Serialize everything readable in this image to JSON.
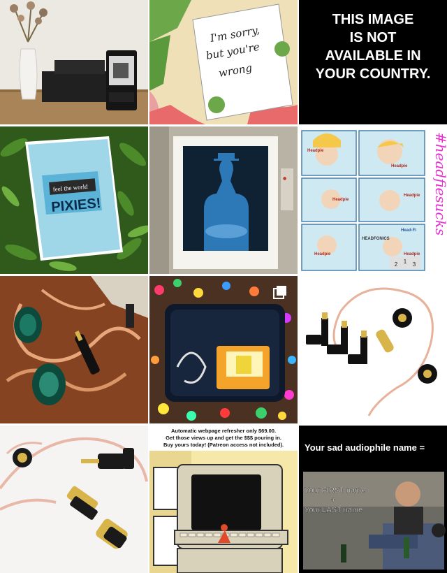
{
  "grid": {
    "posts": [
      {
        "id": "post-1",
        "desc": "headphone amplifier photo"
      },
      {
        "id": "post-2",
        "note_text": [
          "I'm sorry,",
          "but you're",
          "wrong"
        ]
      },
      {
        "id": "post-3",
        "lines": [
          "THIS IMAGE",
          "IS NOT",
          "AVAILABLE IN",
          "YOUR COUNTRY."
        ]
      },
      {
        "id": "post-4",
        "book_tagline": "feel the world",
        "book_title": "PIXIES!"
      },
      {
        "id": "post-5",
        "desc": "painting poster"
      },
      {
        "id": "post-6",
        "hashtag": "#headfiesucks",
        "labels": [
          "Headpie",
          "Headpie",
          "Headpie",
          "Headpie",
          "Headpie",
          "Headpie",
          "HEADFONICS",
          "Head-Fi"
        ],
        "podium": [
          "2",
          "1",
          "3"
        ]
      },
      {
        "id": "post-7",
        "desc": "in-ear monitors and cable"
      },
      {
        "id": "post-8",
        "desc": "carry case and player",
        "multi_icon": "multiple-photos-icon"
      },
      {
        "id": "post-9",
        "desc": "earphones with adapters"
      },
      {
        "id": "post-10",
        "desc": "cable close-up"
      },
      {
        "id": "post-11",
        "caption": [
          "Automatic webpage refresher only $69.00.",
          "Get those views up and get the $$$ pouring in.",
          "Buy yours today! (Patreon access not included)."
        ]
      },
      {
        "id": "post-12",
        "title": "Your sad audiophile name =",
        "first": "Your FIRST name",
        "plus": "+",
        "last": "Your LAST name"
      }
    ]
  }
}
